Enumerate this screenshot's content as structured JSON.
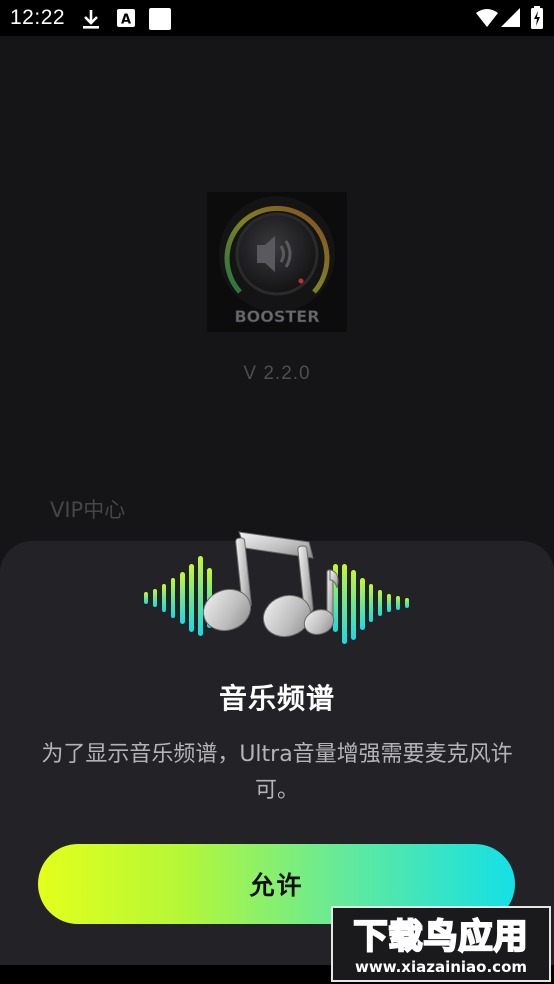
{
  "status_bar": {
    "time": "12:22",
    "icons": [
      "download-icon",
      "a-notification-icon",
      "square-notification-icon",
      "wifi-icon",
      "signal-icon",
      "battery-icon"
    ]
  },
  "background_screen": {
    "logo_text": "BOOSTER",
    "version": "V 2.2.0",
    "vip_label": "VIP中心"
  },
  "dialog": {
    "title": "音乐频谱",
    "description": "为了显示音乐频谱，Ultra音量增强需要麦克风许可。",
    "allow_label": "允许",
    "illustration": "music-notes-equalizer-illustration"
  },
  "watermark": {
    "brand": "下载鸟应用",
    "url": "www.xiazainiao.com"
  },
  "colors": {
    "sheet_bg": "#232327",
    "button_gradient_start": "#e3ff1c",
    "button_gradient_end": "#14e0e6",
    "equalizer_green": "#b8f53a",
    "equalizer_cyan": "#19d9e6"
  }
}
